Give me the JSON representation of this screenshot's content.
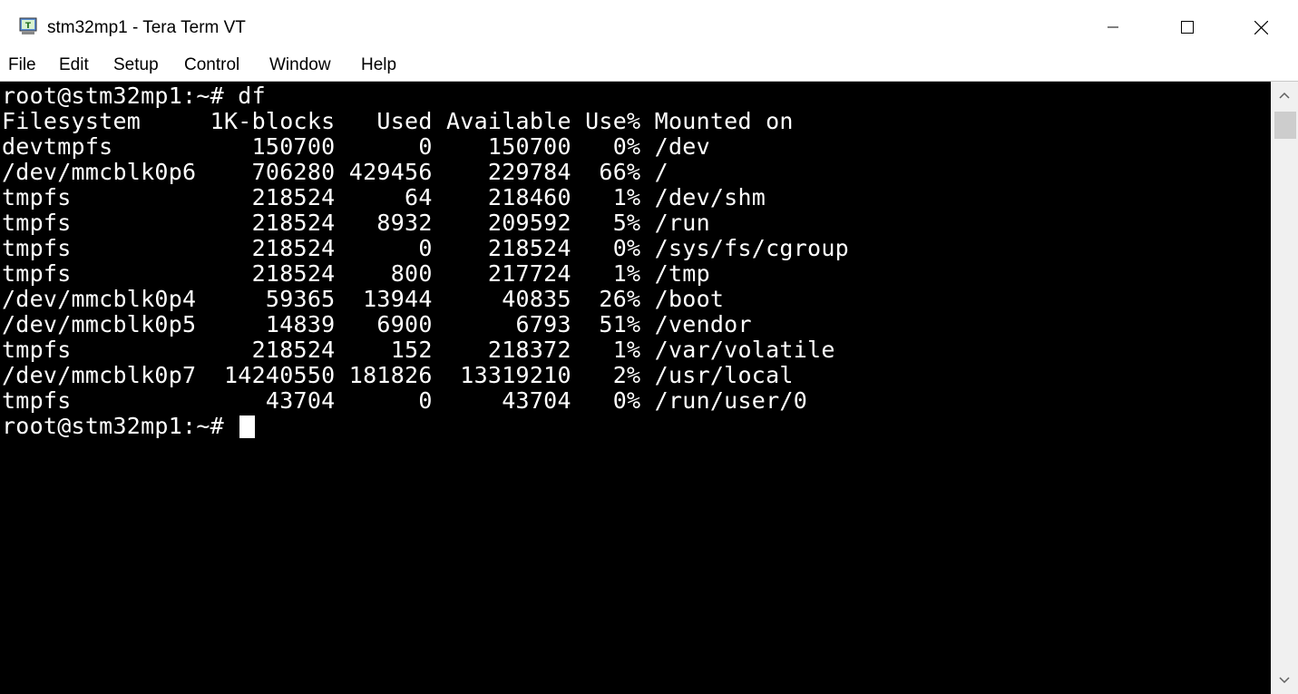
{
  "window": {
    "title": "stm32mp1 - Tera Term VT",
    "app_icon": "teraterm-icon",
    "controls": [
      "minimize-icon",
      "maximize-icon",
      "close-icon"
    ]
  },
  "menu": {
    "items": [
      {
        "label": "File"
      },
      {
        "label": "Edit"
      },
      {
        "label": "Setup"
      },
      {
        "label": "Control"
      },
      {
        "label": "Window"
      },
      {
        "label": "Help"
      }
    ]
  },
  "terminal": {
    "lines": [
      "root@stm32mp1:~# df",
      "Filesystem     1K-blocks   Used Available Use% Mounted on",
      "devtmpfs          150700      0    150700   0% /dev",
      "/dev/mmcblk0p6    706280 429456    229784  66% /",
      "tmpfs             218524     64    218460   1% /dev/shm",
      "tmpfs             218524   8932    209592   5% /run",
      "tmpfs             218524      0    218524   0% /sys/fs/cgroup",
      "tmpfs             218524    800    217724   1% /tmp",
      "/dev/mmcblk0p4     59365  13944     40835  26% /boot",
      "/dev/mmcblk0p5     14839   6900      6793  51% /vendor",
      "tmpfs             218524    152    218372   1% /var/volatile",
      "/dev/mmcblk0p7  14240550 181826  13319210   2% /usr/local",
      "tmpfs              43704      0     43704   0% /run/user/0"
    ],
    "prompt": "root@stm32mp1:~# ",
    "colors": {
      "background": "#000000",
      "foreground": "#ffffff"
    }
  },
  "scrollbar": {
    "up_icon": "scroll-up-arrow-icon",
    "down_icon": "scroll-down-arrow-icon"
  }
}
